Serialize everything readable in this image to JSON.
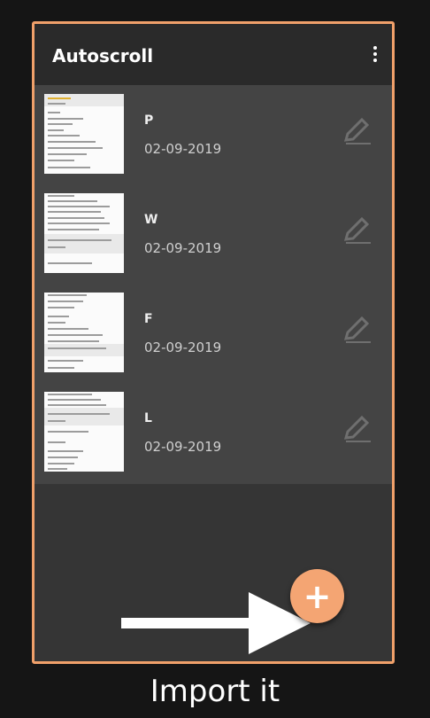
{
  "appbar": {
    "title": "Autoscroll",
    "menu_icon": "more-vert-icon"
  },
  "songs": [
    {
      "title": "P",
      "date": "02-09-2019"
    },
    {
      "title": "W",
      "date": "02-09-2019"
    },
    {
      "title": "F",
      "date": "02-09-2019"
    },
    {
      "title": "L",
      "date": "02-09-2019"
    }
  ],
  "fab": {
    "label": "+"
  },
  "caption": "Import it",
  "colors": {
    "accent": "#f4a573",
    "frame": "#f0a06a",
    "list_bg": "#444444",
    "panel_bg": "#353535"
  }
}
